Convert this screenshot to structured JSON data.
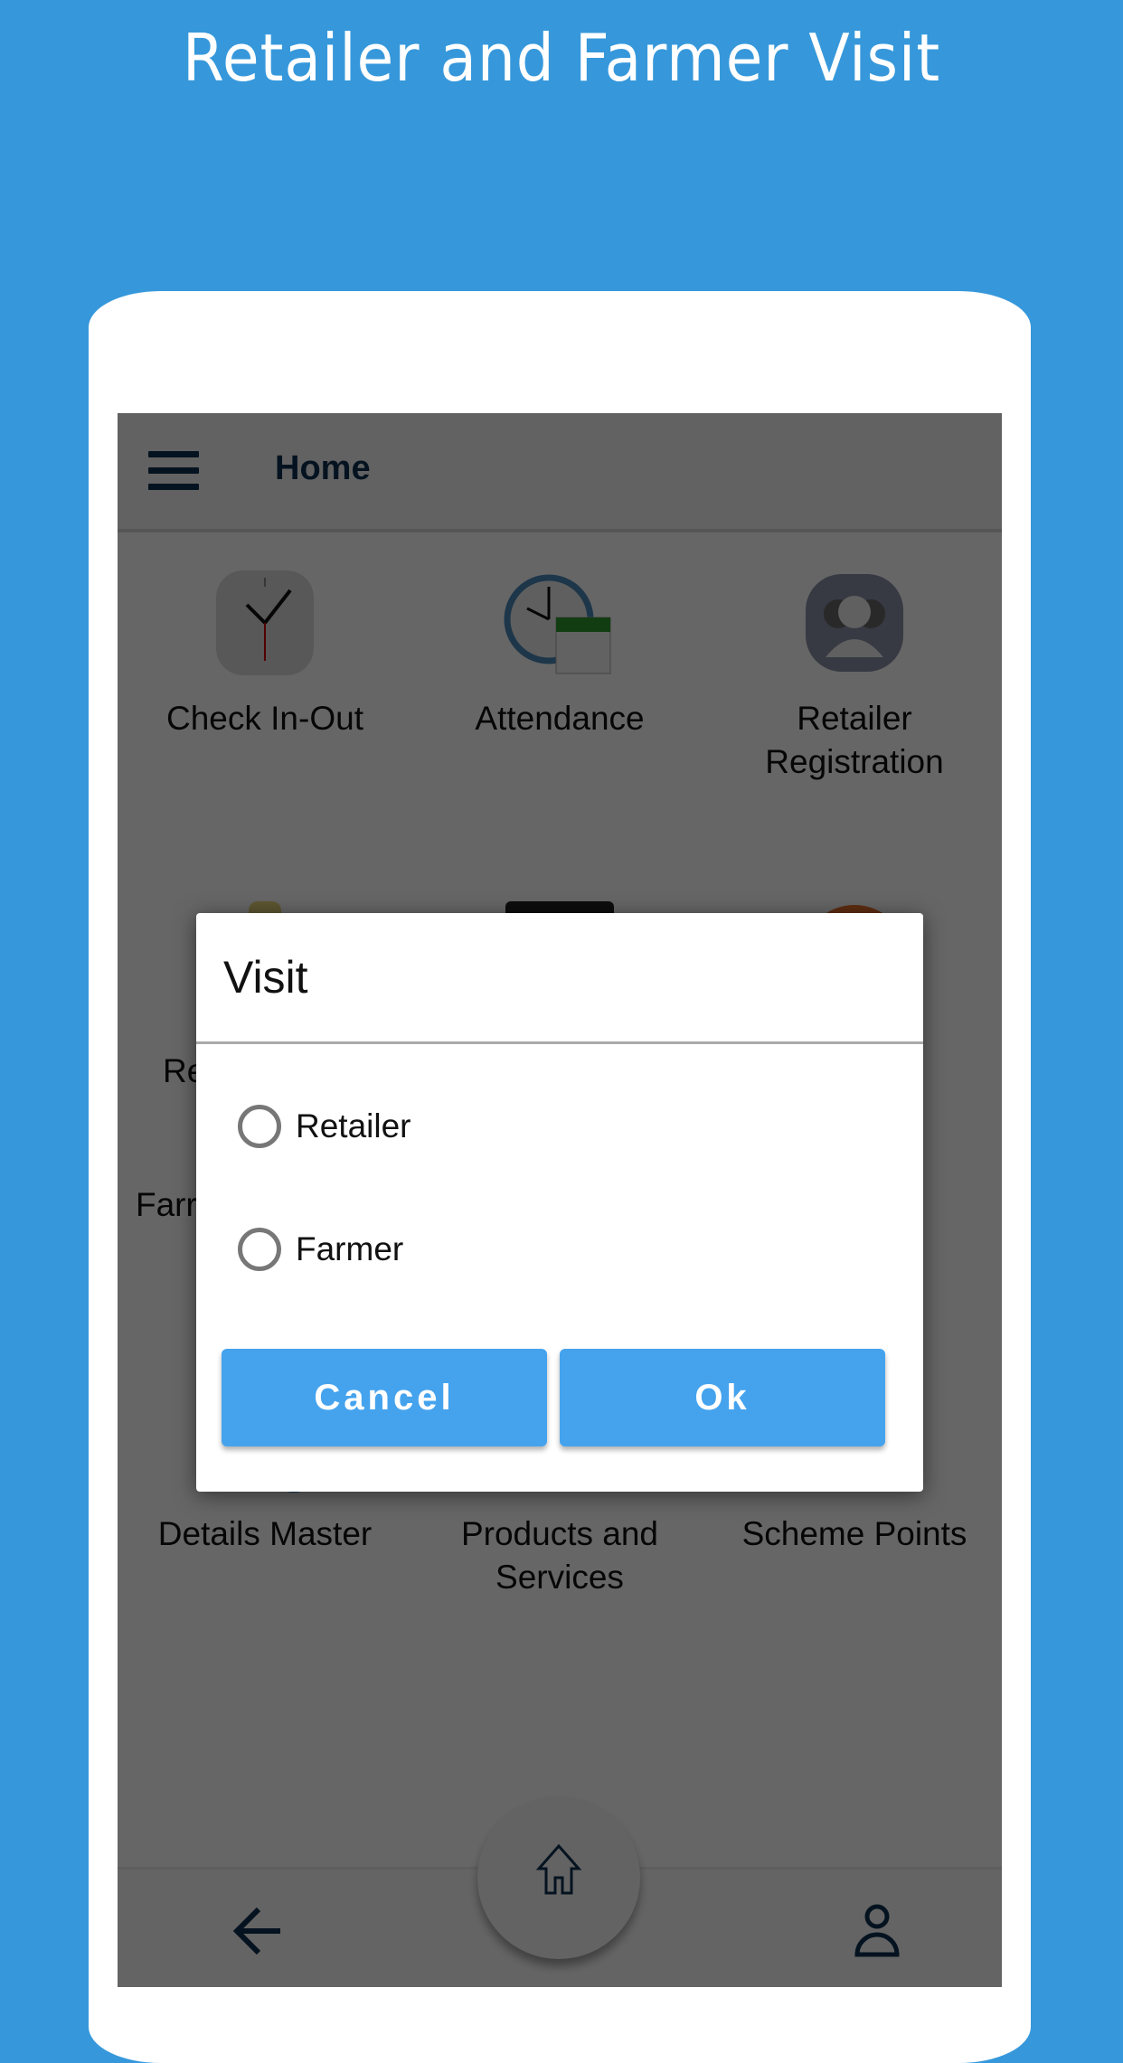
{
  "promo": {
    "title": "Retailer and Farmer Visit"
  },
  "app": {
    "header": {
      "title": "Home",
      "menu_icon": "hamburger-menu-icon"
    },
    "tiles": [
      {
        "label": "Check In-Out",
        "icon": "clock-icon"
      },
      {
        "label": "Attendance",
        "icon": "clock-calendar-icon"
      },
      {
        "label": "Retailer Registration",
        "icon": "users-icon"
      },
      {
        "label": "Re",
        "icon": "document-icon"
      },
      {
        "label": "",
        "icon": "laptop-icon"
      },
      {
        "label": "",
        "icon": "orange-circle-icon"
      },
      {
        "label": "Farr",
        "icon": "farmer-icon"
      },
      {
        "label": "Details Master",
        "icon": "info-folder-icon"
      },
      {
        "label": "Products and Services",
        "icon": "newspaper-icon"
      },
      {
        "label": "Scheme Points",
        "icon": "trophy-icon"
      }
    ],
    "bottom_nav": {
      "back_icon": "arrow-left-icon",
      "home_icon": "home-icon",
      "profile_icon": "user-icon"
    }
  },
  "dialog": {
    "title": "Visit",
    "options": [
      {
        "label": "Retailer",
        "selected": false
      },
      {
        "label": "Farmer",
        "selected": false
      }
    ],
    "cancel_label": "Cancel",
    "ok_label": "Ok"
  },
  "colors": {
    "background": "#3698DB",
    "button": "#45A3EE",
    "header_text": "#0d3150"
  }
}
